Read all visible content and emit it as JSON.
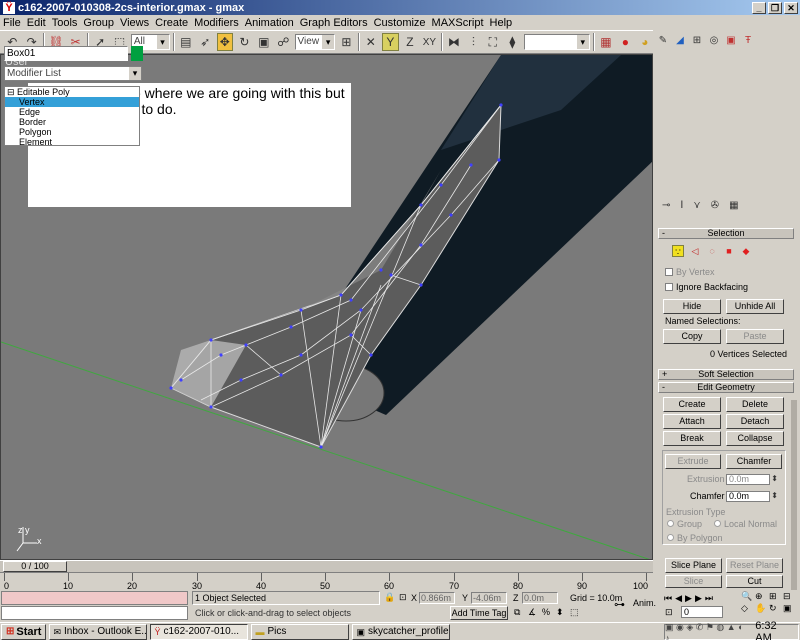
{
  "window": {
    "title": "c162-2007-010308-2cs-interior.gmax - gmax",
    "controls": [
      "_",
      "❐",
      "✕"
    ]
  },
  "menu": [
    "File",
    "Edit",
    "Tools",
    "Group",
    "Views",
    "Create",
    "Modifiers",
    "Animation",
    "Graph Editors",
    "Customize",
    "MAXScript",
    "Help"
  ],
  "toolbar": {
    "selection_filter": "All",
    "reference_coord": "View",
    "named_selection": ""
  },
  "viewport": {
    "label": "User",
    "annotation": "Here you can see where we are going with this but there is much yet to do.",
    "axis_z": "z",
    "axis_y": "y",
    "axis_x": "x"
  },
  "command_panel": {
    "object_name": "Box01",
    "object_color": "#00a040",
    "modifier_list": "Modifier List",
    "stack": {
      "root": "Editable Poly",
      "items": [
        "Vertex",
        "Edge",
        "Border",
        "Polygon",
        "Element"
      ],
      "selected": "Vertex"
    },
    "selection": {
      "header": "Selection",
      "by_vertex": "By Vertex",
      "ignore_backfacing": "Ignore Backfacing",
      "hide": "Hide",
      "unhide_all": "Unhide All",
      "named_selections": "Named Selections:",
      "copy": "Copy",
      "paste": "Paste",
      "status": "0 Vertices Selected"
    },
    "soft_selection": "Soft Selection",
    "edit_geometry": {
      "header": "Edit Geometry",
      "create": "Create",
      "delete": "Delete",
      "attach": "Attach",
      "detach": "Detach",
      "break": "Break",
      "collapse": "Collapse",
      "extrude": "Extrude",
      "chamfer": "Chamfer",
      "extrusion_label": "Extrusion",
      "extrusion_value": "0.0m",
      "chamfer_label": "Chamfer",
      "chamfer_value": "0.0m",
      "extrusion_type": "Extrusion Type",
      "group": "Group",
      "local_normal": "Local Normal",
      "by_polygon": "By Polygon",
      "slice_plane": "Slice Plane",
      "reset_plane": "Reset Plane",
      "slice": "Slice",
      "cut": "Cut"
    }
  },
  "timeline": {
    "slider": "0 / 100",
    "ticks": [
      "0",
      "10",
      "20",
      "30",
      "40",
      "50",
      "60",
      "70",
      "80",
      "90",
      "100"
    ]
  },
  "status": {
    "selected": "1 Object Selected",
    "prompt": "Click or click-and-drag to select objects",
    "x_label": "X",
    "x_value": "0.866m",
    "y_label": "Y",
    "y_value": "-4.06m",
    "z_label": "Z",
    "z_value": "0.0m",
    "grid": "Grid = 10.0m",
    "add_time_tag": "Add Time Tag",
    "anim": "Anim.",
    "frame": "0"
  },
  "taskbar": {
    "start": "Start",
    "tasks": [
      "Inbox - Outlook E...",
      "c162-2007-010...",
      "Pics",
      "skycatcher_profile..."
    ],
    "active_task": 1,
    "clock": "6:32 AM"
  }
}
